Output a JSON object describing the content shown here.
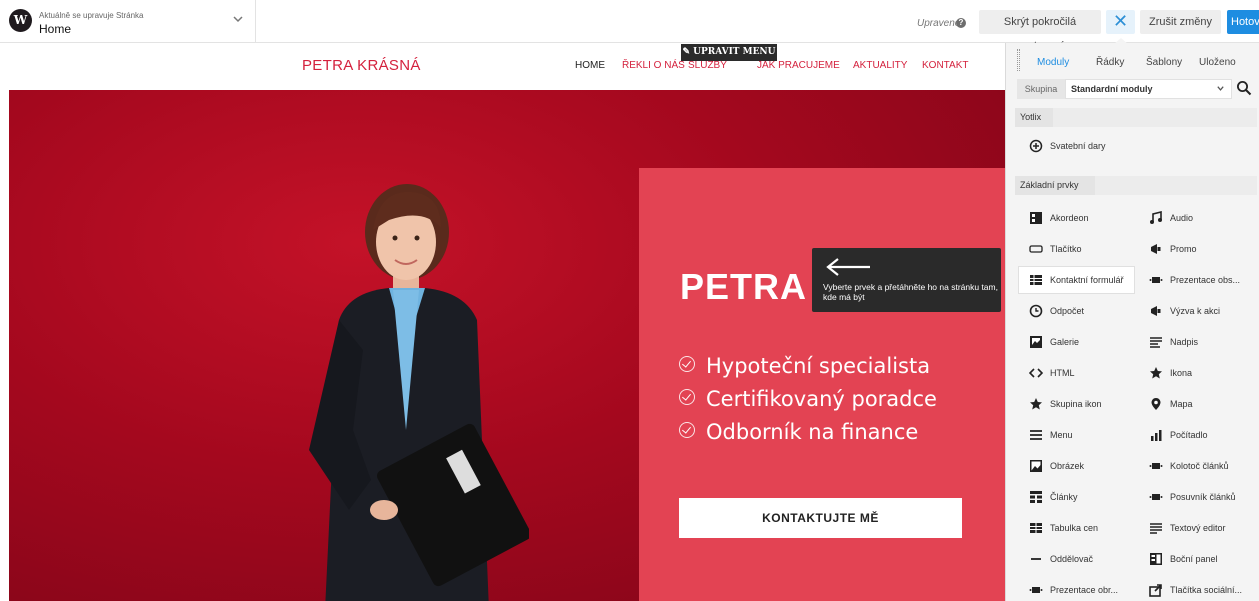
{
  "topbar": {
    "status_small": "Aktuálně se upravuje Stránka",
    "status_page": "Home",
    "saved": "Upraveno",
    "help": "?",
    "hide_advanced": "Skrýt pokročilá nastavení",
    "close": "✕",
    "discard": "Zrušit změny",
    "done": "Hotovo"
  },
  "site": {
    "logo": "PETRA KRÁSNÁ",
    "nav": [
      "HOME",
      "ŘEKLI O NÁS",
      "SLUŽBY",
      "JAK PRACUJEME",
      "AKTUALITY",
      "KONTAKT"
    ],
    "edit_menu": "✎ UPRAVIT MENU"
  },
  "hero": {
    "title": "PETRA K",
    "lines": [
      "Hypoteční specialista",
      "Certifikovaný poradce",
      "Odborník na finance"
    ],
    "cta": "KONTAKTUJTE MĚ"
  },
  "tooltip": {
    "text": "Vyberte prvek a přetáhněte ho na stránku tam, kde má být"
  },
  "panel": {
    "tabs": [
      "Moduly",
      "Řádky",
      "Šablony",
      "Uloženo"
    ],
    "group_label": "Skupina",
    "group_value": "Standardní moduly",
    "section_yotlix": "Yotlix",
    "yotlix_modules": [
      {
        "label": "Svatební dary",
        "icon": "plus-circle-icon"
      }
    ],
    "section_basic": "Základní prvky",
    "modules": [
      {
        "label": "Akordeon",
        "icon": "accordion-icon"
      },
      {
        "label": "Audio",
        "icon": "music-note-icon"
      },
      {
        "label": "Tlačítko",
        "icon": "button-icon"
      },
      {
        "label": "Promo",
        "icon": "megaphone-icon"
      },
      {
        "label": "Kontaktní formulář",
        "icon": "form-table-icon"
      },
      {
        "label": "Prezentace obs...",
        "icon": "slides-icon"
      },
      {
        "label": "Odpočet",
        "icon": "clock-icon"
      },
      {
        "label": "Výzva k akci",
        "icon": "megaphone-icon"
      },
      {
        "label": "Galerie",
        "icon": "gallery-icon"
      },
      {
        "label": "Nadpis",
        "icon": "heading-icon"
      },
      {
        "label": "HTML",
        "icon": "code-icon"
      },
      {
        "label": "Ikona",
        "icon": "star-icon"
      },
      {
        "label": "Skupina ikon",
        "icon": "star-icon"
      },
      {
        "label": "Mapa",
        "icon": "map-pin-icon"
      },
      {
        "label": "Menu",
        "icon": "menu-icon"
      },
      {
        "label": "Počítadlo",
        "icon": "bar-chart-icon"
      },
      {
        "label": "Obrázek",
        "icon": "image-icon"
      },
      {
        "label": "Kolotoč článků",
        "icon": "slides-icon"
      },
      {
        "label": "Články",
        "icon": "posts-grid-icon"
      },
      {
        "label": "Posuvník článků",
        "icon": "slides-icon"
      },
      {
        "label": "Tabulka cen",
        "icon": "table-icon"
      },
      {
        "label": "Textový editor",
        "icon": "text-editor-icon"
      },
      {
        "label": "Oddělovač",
        "icon": "separator-icon"
      },
      {
        "label": "Boční panel",
        "icon": "sidebar-panel-icon"
      },
      {
        "label": "Prezentace obr...",
        "icon": "slides-icon"
      },
      {
        "label": "Tlačítka sociální...",
        "icon": "share-icon"
      }
    ]
  },
  "colors": {
    "brand_red": "#d4213d",
    "hero_card": "#e34353",
    "accent_blue": "#1e8de1"
  }
}
